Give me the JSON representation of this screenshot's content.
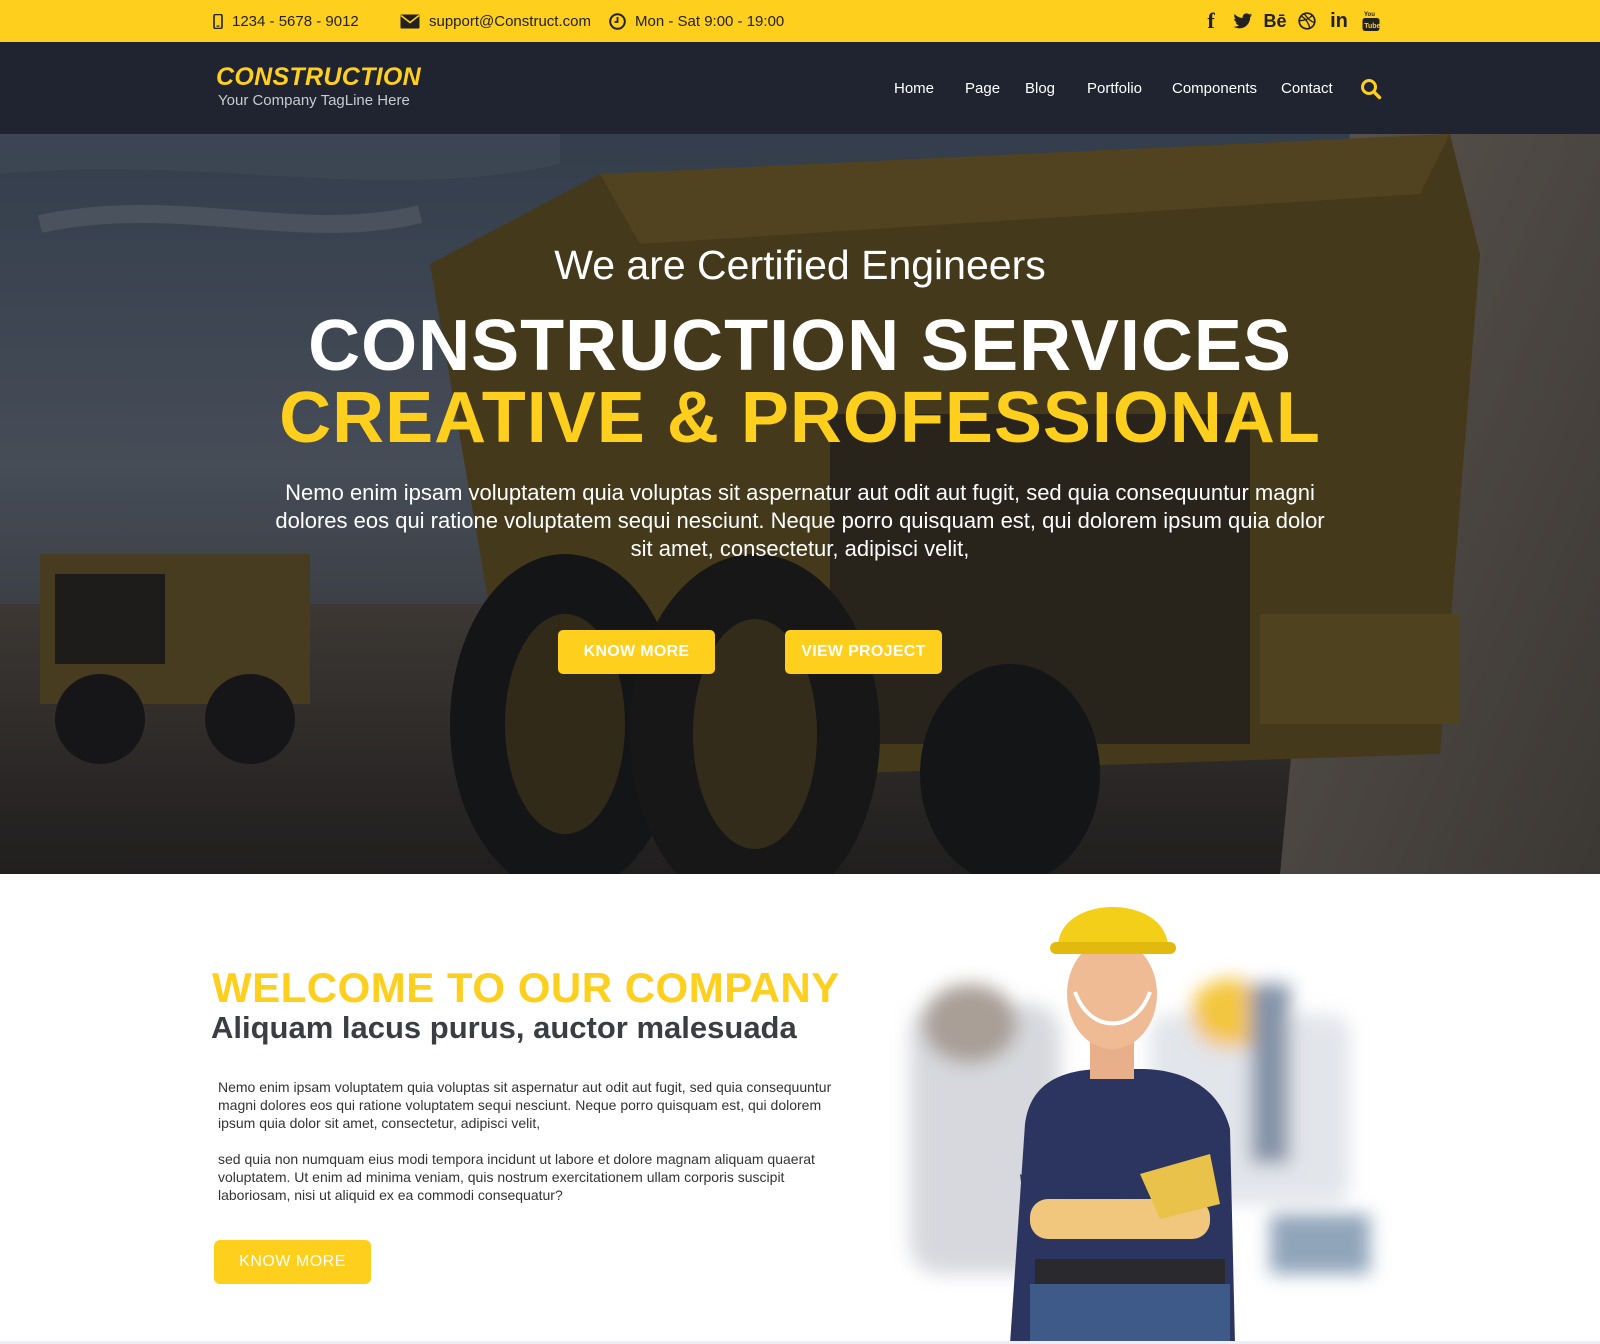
{
  "topbar": {
    "phone": "1234 - 5678 - 9012",
    "email": "support@Construct.com",
    "hours": "Mon - Sat 9:00 - 19:00",
    "socials": [
      {
        "name": "facebook",
        "glyph": "f"
      },
      {
        "name": "twitter",
        "glyph": ""
      },
      {
        "name": "behance",
        "glyph": "Bē"
      },
      {
        "name": "dribbble",
        "glyph": ""
      },
      {
        "name": "linkedin",
        "glyph": "in"
      },
      {
        "name": "youtube",
        "glyph": ""
      }
    ]
  },
  "header": {
    "logo_title": "CONSTRUCTION",
    "logo_tagline": "Your Company TagLine Here",
    "menu": [
      "Home",
      "Page",
      "Blog",
      "Portfolio",
      "Components",
      "Contact"
    ]
  },
  "hero": {
    "subtitle": "We are Certified Engineers",
    "title_line1": "CONSTRUCTION SERVICES",
    "title_line2": "CREATIVE & PROFESSIONAL",
    "text": "Nemo enim ipsam voluptatem quia voluptas sit aspernatur aut odit aut fugit, sed quia consequuntur magni dolores eos qui ratione voluptatem sequi nesciunt. Neque porro quisquam est, qui dolorem ipsum quia dolor sit amet, consectetur, adipisci velit,",
    "btn_know_more": "KNOW MORE",
    "btn_view_project": "VIEW PROJECT"
  },
  "welcome": {
    "title": "WELCOME TO OUR COMPANY",
    "subtitle": "Aliquam lacus purus, auctor malesuada",
    "para1": "Nemo enim ipsam voluptatem quia voluptas sit aspernatur aut odit aut fugit, sed quia consequuntur magni dolores eos qui ratione voluptatem sequi nesciunt. Neque porro quisquam est, qui dolorem ipsum quia dolor sit amet, consectetur, adipisci velit,",
    "para2": "sed quia non numquam eius modi tempora incidunt ut labore et dolore magnam aliquam quaerat voluptatem. Ut enim ad minima veniam, quis nostrum exercitationem ullam corporis suscipit laboriosam, nisi ut aliquid ex ea commodi consequatur?",
    "btn": "KNOW MORE"
  },
  "colors": {
    "accent": "#fecf1c",
    "nav_bg": "#1f2430",
    "heading_dark": "#3a3d44"
  },
  "icons": [
    "phone-icon",
    "mail-icon",
    "clock-icon",
    "search-icon"
  ]
}
